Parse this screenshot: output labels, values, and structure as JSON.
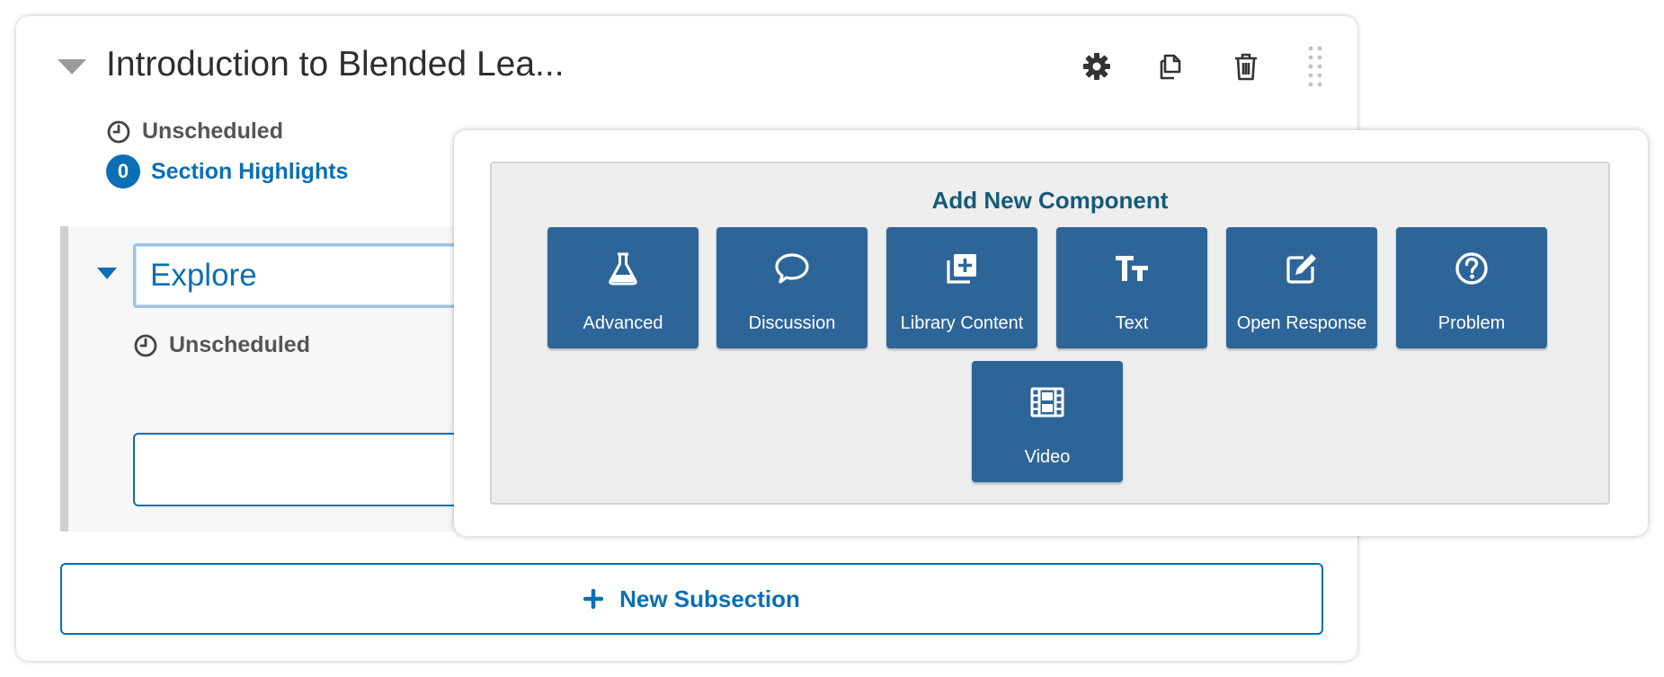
{
  "section": {
    "title": "Introduction to Blended Lea...",
    "schedule": "Unscheduled",
    "highlights_count": "0",
    "highlights_label": "Section Highlights"
  },
  "subsection": {
    "name": "Explore",
    "schedule": "Unscheduled"
  },
  "new_subsection_label": "New Subsection",
  "add_component": {
    "title": "Add New Component",
    "buttons": [
      {
        "label": "Advanced",
        "icon": "flask-icon"
      },
      {
        "label": "Discussion",
        "icon": "speech-bubble-icon"
      },
      {
        "label": "Library Content",
        "icon": "library-add-icon"
      },
      {
        "label": "Text",
        "icon": "text-size-icon"
      },
      {
        "label": "Open Response",
        "icon": "edit-icon"
      },
      {
        "label": "Problem",
        "icon": "question-circle-icon"
      },
      {
        "label": "Video",
        "icon": "film-icon"
      }
    ]
  },
  "colors": {
    "accent": "#0a6fb5",
    "component_button": "#2e6599",
    "panel_bg": "#eeeeee",
    "title_text": "#155a7a"
  }
}
